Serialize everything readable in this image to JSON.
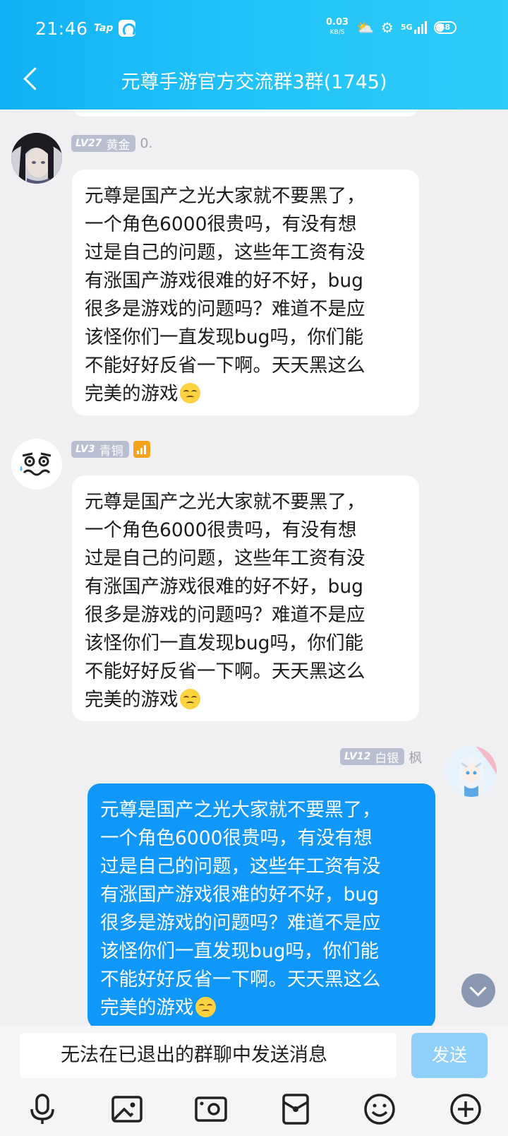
{
  "status_bar": {
    "time": "21:46",
    "app_badge": "Tap",
    "net_speed_value": "0.03",
    "net_speed_unit": "KB/S",
    "signal_label": "5G",
    "battery": "48"
  },
  "header": {
    "title": "元尊手游官方交流群3群(1745)"
  },
  "messages": [
    {
      "side": "in",
      "level": "LV27",
      "rank": "黄金",
      "nickname": "0.",
      "text": "元尊是国产之光大家就不要黑了，\n一个角色6000很贵吗，有没有想\n过是自己的问题，这些年工资有没\n有涨国产游戏很难的好不好，bug\n很多是游戏的问题吗？难道不是应\n该怪你们一直发现bug吗，你们能\n不能好好反省一下啊。天天黑这么\n完美的游戏",
      "emoji": "disappointed-face"
    },
    {
      "side": "in",
      "level": "LV3",
      "rank": "青铜",
      "nickname": "",
      "text": "元尊是国产之光大家就不要黑了，\n一个角色6000很贵吗，有没有想\n过是自己的问题，这些年工资有没\n有涨国产游戏很难的好不好，bug\n很多是游戏的问题吗？难道不是应\n该怪你们一直发现bug吗，你们能\n不能好好反省一下啊。天天黑这么\n完美的游戏",
      "emoji": "disappointed-face"
    },
    {
      "side": "out",
      "level": "LV12",
      "rank": "白银",
      "nickname": "枫",
      "text": "元尊是国产之光大家就不要黑了，\n一个角色6000很贵吗，有没有想\n过是自己的问题，这些年工资有没\n有涨国产游戏很难的好不好，bug\n很多是游戏的问题吗？难道不是应\n该怪你们一直发现bug吗，你们能\n不能好好反省一下啊。天天黑这么\n完美的游戏",
      "emoji": "disappointed-face"
    }
  ],
  "input": {
    "placeholder": "无法在已退出的群聊中发送消息",
    "send_label": "发送"
  },
  "toolbar": [
    "voice-icon",
    "image-icon",
    "camera-icon",
    "red-packet-icon",
    "emoji-icon",
    "plus-icon"
  ],
  "colors": {
    "header_gradient_start": "#10b2f5",
    "header_gradient_end": "#2fcbf7",
    "outgoing_bubble": "#0f97f9",
    "incoming_bubble": "#ffffff",
    "chat_background": "#f0f0f2",
    "send_button_disabled": "#8fd0fb"
  }
}
